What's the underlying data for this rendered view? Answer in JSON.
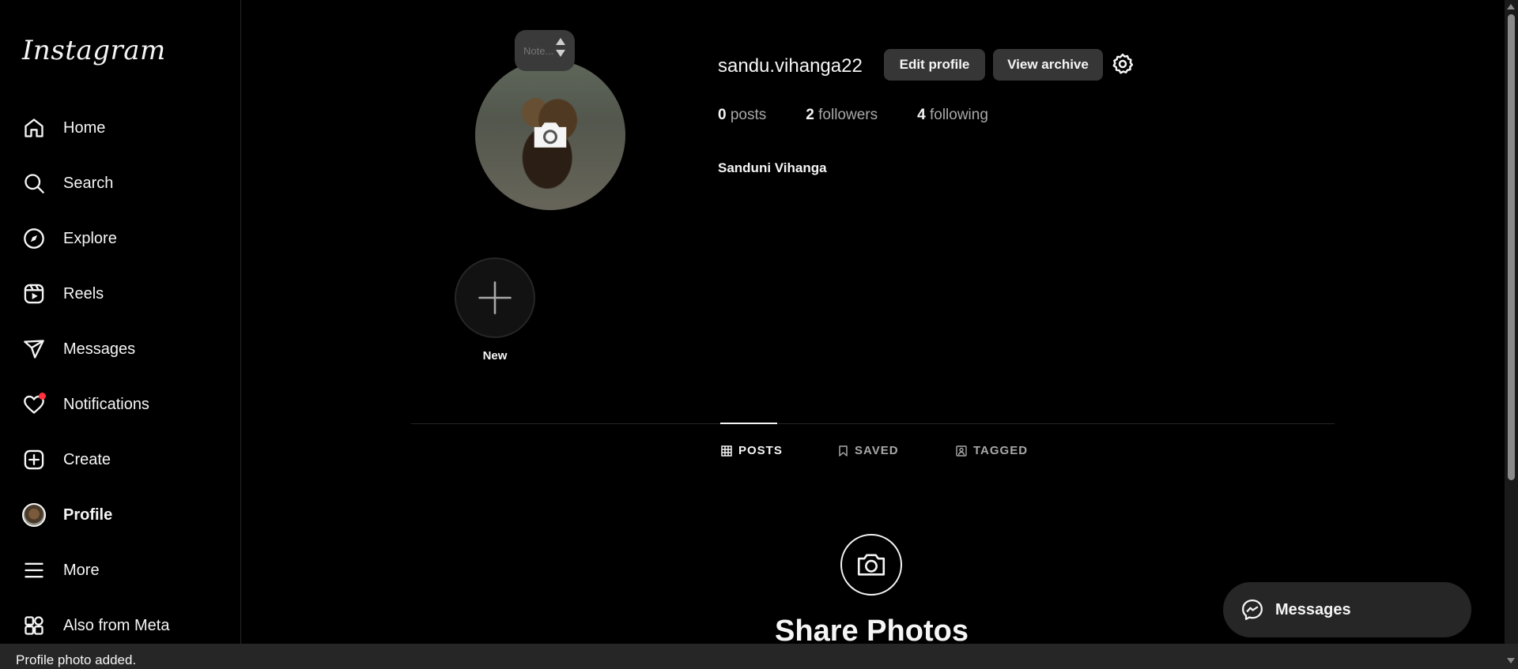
{
  "app": {
    "logo": "Instagram"
  },
  "sidebar": {
    "items": [
      {
        "label": "Home",
        "icon": "home-icon"
      },
      {
        "label": "Search",
        "icon": "search-icon"
      },
      {
        "label": "Explore",
        "icon": "compass-icon"
      },
      {
        "label": "Reels",
        "icon": "reels-icon"
      },
      {
        "label": "Messages",
        "icon": "paper-plane-icon"
      },
      {
        "label": "Notifications",
        "icon": "heart-icon"
      },
      {
        "label": "Create",
        "icon": "plus-square-icon"
      },
      {
        "label": "Profile",
        "icon": "avatar"
      },
      {
        "label": "More",
        "icon": "menu-icon"
      },
      {
        "label": "Also from Meta",
        "icon": "grid-icon"
      }
    ]
  },
  "profile": {
    "note_placeholder": "Note...",
    "username": "sandu.vihanga22",
    "edit_label": "Edit profile",
    "archive_label": "View archive",
    "stats": {
      "posts_count": "0",
      "posts_word": "posts",
      "followers_count": "2",
      "followers_word": "followers",
      "following_count": "4",
      "following_word": "following"
    },
    "full_name": "Sanduni Vihanga"
  },
  "highlights": {
    "new_label": "New"
  },
  "tabs": {
    "posts": "POSTS",
    "saved": "SAVED",
    "tagged": "TAGGED"
  },
  "empty_state": {
    "title": "Share Photos"
  },
  "messages_pill": {
    "label": "Messages"
  },
  "toast": {
    "text": "Profile photo added."
  },
  "colors": {
    "accent_red": "#ff3040",
    "button_bg": "#363636",
    "bg": "#000000"
  }
}
